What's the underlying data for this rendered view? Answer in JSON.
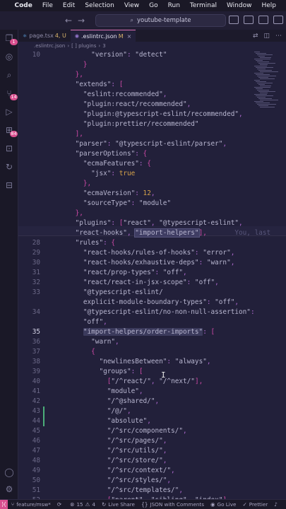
{
  "menubar": {
    "app": "Code",
    "items": [
      "File",
      "Edit",
      "Selection",
      "View",
      "Go",
      "Run",
      "Terminal",
      "Window",
      "Help"
    ]
  },
  "titlebar": {
    "search_text": "youtube-template",
    "back_icon": "arrow-left-icon",
    "forward_icon": "arrow-right-icon"
  },
  "activity": {
    "explorer_badge": "1",
    "scm_badge": "14",
    "extensions_badge": "84"
  },
  "tabs": [
    {
      "label": "page.tsx",
      "suffix": "4, U",
      "active": false
    },
    {
      "label": ".eslintrc.json",
      "suffix": "M",
      "active": true
    }
  ],
  "breadcrumb": {
    "file": ".eslintrc.json",
    "segment": "[ ] plugins",
    "index": "3"
  },
  "editor": {
    "lines": [
      {
        "n": "10",
        "tokens": [
          [
            "        ",
            "s"
          ],
          [
            "\"version\"",
            "k"
          ],
          [
            ": ",
            "p"
          ],
          [
            "\"detect\"",
            "s"
          ]
        ]
      },
      {
        "n": "",
        "tokens": [
          [
            "      ",
            "s"
          ],
          [
            "}",
            "b"
          ]
        ]
      },
      {
        "n": "",
        "tokens": [
          [
            "    ",
            "s"
          ],
          [
            "},",
            "b"
          ]
        ]
      },
      {
        "n": "",
        "tokens": [
          [
            "    ",
            "s"
          ],
          [
            "\"extends\"",
            "k"
          ],
          [
            ": ",
            "p"
          ],
          [
            "[",
            "b"
          ]
        ]
      },
      {
        "n": "",
        "tokens": [
          [
            "      ",
            "s"
          ],
          [
            "\"eslint:recommended\"",
            "s"
          ],
          [
            ",",
            "p"
          ]
        ]
      },
      {
        "n": "",
        "tokens": [
          [
            "      ",
            "s"
          ],
          [
            "\"plugin:react/recommended\"",
            "s"
          ],
          [
            ",",
            "p"
          ]
        ]
      },
      {
        "n": "",
        "tokens": [
          [
            "      ",
            "s"
          ],
          [
            "\"plugin:@typescript-eslint/recommended\"",
            "s"
          ],
          [
            ",",
            "p"
          ]
        ]
      },
      {
        "n": "",
        "tokens": [
          [
            "      ",
            "s"
          ],
          [
            "\"plugin:prettier/recommended\"",
            "s"
          ]
        ]
      },
      {
        "n": "",
        "tokens": [
          [
            "    ",
            "s"
          ],
          [
            "],",
            "b"
          ]
        ]
      },
      {
        "n": "",
        "tokens": [
          [
            "    ",
            "s"
          ],
          [
            "\"parser\"",
            "k"
          ],
          [
            ": ",
            "p"
          ],
          [
            "\"@typescript-eslint/parser\"",
            "s"
          ],
          [
            ",",
            "p"
          ]
        ]
      },
      {
        "n": "",
        "tokens": [
          [
            "    ",
            "s"
          ],
          [
            "\"parserOptions\"",
            "k"
          ],
          [
            ": ",
            "p"
          ],
          [
            "{",
            "b"
          ]
        ]
      },
      {
        "n": "",
        "tokens": [
          [
            "      ",
            "s"
          ],
          [
            "\"ecmaFeatures\"",
            "k"
          ],
          [
            ": ",
            "p"
          ],
          [
            "{",
            "b"
          ]
        ]
      },
      {
        "n": "",
        "tokens": [
          [
            "        ",
            "s"
          ],
          [
            "\"jsx\"",
            "k"
          ],
          [
            ": ",
            "p"
          ],
          [
            "true",
            "n"
          ]
        ]
      },
      {
        "n": "",
        "tokens": [
          [
            "      ",
            "s"
          ],
          [
            "},",
            "b"
          ]
        ]
      },
      {
        "n": "",
        "tokens": [
          [
            "      ",
            "s"
          ],
          [
            "\"ecmaVersion\"",
            "k"
          ],
          [
            ": ",
            "p"
          ],
          [
            "12",
            "n"
          ],
          [
            ",",
            "p"
          ]
        ]
      },
      {
        "n": "",
        "tokens": [
          [
            "      ",
            "s"
          ],
          [
            "\"sourceType\"",
            "k"
          ],
          [
            ": ",
            "p"
          ],
          [
            "\"module\"",
            "s"
          ]
        ]
      },
      {
        "n": "",
        "tokens": [
          [
            "    ",
            "s"
          ],
          [
            "},",
            "b"
          ]
        ]
      },
      {
        "n": "",
        "tokens": [
          [
            "    ",
            "s"
          ],
          [
            "\"plugins\"",
            "k"
          ],
          [
            ": ",
            "p"
          ],
          [
            "[",
            "b"
          ],
          [
            "\"react\"",
            "s"
          ],
          [
            ", ",
            "p"
          ],
          [
            "\"@typescript-eslint\"",
            "s"
          ],
          [
            ",",
            "p"
          ]
        ]
      },
      {
        "n": "",
        "tokens": [
          [
            "    ",
            "s"
          ],
          [
            "\"react-hooks\"",
            "s"
          ],
          [
            ", ",
            "p"
          ],
          [
            "\"import-helpers\"",
            "s"
          ],
          [
            "],",
            "b"
          ],
          [
            "       You, last",
            "g"
          ]
        ]
      },
      {
        "n": "28",
        "tokens": [
          [
            "    ",
            "s"
          ],
          [
            "\"rules\"",
            "k"
          ],
          [
            ": ",
            "p"
          ],
          [
            "{",
            "b"
          ]
        ]
      },
      {
        "n": "29",
        "tokens": [
          [
            "      ",
            "s"
          ],
          [
            "\"react-hooks/rules-of-hooks\"",
            "k"
          ],
          [
            ": ",
            "p"
          ],
          [
            "\"error\"",
            "s"
          ],
          [
            ",",
            "p"
          ]
        ]
      },
      {
        "n": "30",
        "tokens": [
          [
            "      ",
            "s"
          ],
          [
            "\"react-hooks/exhaustive-deps\"",
            "k"
          ],
          [
            ": ",
            "p"
          ],
          [
            "\"warn\"",
            "s"
          ],
          [
            ",",
            "p"
          ]
        ]
      },
      {
        "n": "31",
        "tokens": [
          [
            "      ",
            "s"
          ],
          [
            "\"react/prop-types\"",
            "k"
          ],
          [
            ": ",
            "p"
          ],
          [
            "\"off\"",
            "s"
          ],
          [
            ",",
            "p"
          ]
        ]
      },
      {
        "n": "32",
        "tokens": [
          [
            "      ",
            "s"
          ],
          [
            "\"react/react-in-jsx-scope\"",
            "k"
          ],
          [
            ": ",
            "p"
          ],
          [
            "\"off\"",
            "s"
          ],
          [
            ",",
            "p"
          ]
        ]
      },
      {
        "n": "33",
        "tokens": [
          [
            "      ",
            "s"
          ],
          [
            "\"@typescript-eslint/",
            "k"
          ]
        ]
      },
      {
        "n": "",
        "tokens": [
          [
            "      ",
            "s"
          ],
          [
            "explicit-module-boundary-types\"",
            "k"
          ],
          [
            ": ",
            "p"
          ],
          [
            "\"off\"",
            "s"
          ],
          [
            ",",
            "p"
          ]
        ]
      },
      {
        "n": "34",
        "tokens": [
          [
            "      ",
            "s"
          ],
          [
            "\"@typescript-eslint/no-non-null-assertion\"",
            "k"
          ],
          [
            ":",
            "p"
          ]
        ]
      },
      {
        "n": "",
        "tokens": [
          [
            "      ",
            "s"
          ],
          [
            "\"off\"",
            "s"
          ],
          [
            ",",
            "p"
          ]
        ]
      },
      {
        "n": "35",
        "tokens": [
          [
            "      ",
            "s"
          ],
          [
            "\"import-helpers/order-imports\"",
            "k"
          ],
          [
            ": ",
            "p"
          ],
          [
            "[",
            "b"
          ]
        ]
      },
      {
        "n": "36",
        "tokens": [
          [
            "        ",
            "s"
          ],
          [
            "\"warn\"",
            "s"
          ],
          [
            ",",
            "p"
          ]
        ]
      },
      {
        "n": "37",
        "tokens": [
          [
            "        ",
            "s"
          ],
          [
            "{",
            "b"
          ]
        ]
      },
      {
        "n": "38",
        "tokens": [
          [
            "          ",
            "s"
          ],
          [
            "\"newlinesBetween\"",
            "k"
          ],
          [
            ": ",
            "p"
          ],
          [
            "\"always\"",
            "s"
          ],
          [
            ",",
            "p"
          ]
        ]
      },
      {
        "n": "39",
        "tokens": [
          [
            "          ",
            "s"
          ],
          [
            "\"groups\"",
            "k"
          ],
          [
            ": ",
            "p"
          ],
          [
            "[",
            "b"
          ]
        ]
      },
      {
        "n": "40",
        "tokens": [
          [
            "            ",
            "s"
          ],
          [
            "[",
            "b"
          ],
          [
            "\"/^react/\"",
            "s"
          ],
          [
            ", ",
            "p"
          ],
          [
            "\"/^next/\"",
            "s"
          ],
          [
            "],",
            "b"
          ]
        ]
      },
      {
        "n": "41",
        "tokens": [
          [
            "            ",
            "s"
          ],
          [
            "\"module\"",
            "s"
          ],
          [
            ",",
            "p"
          ]
        ]
      },
      {
        "n": "42",
        "tokens": [
          [
            "            ",
            "s"
          ],
          [
            "\"/^@shared/\"",
            "s"
          ],
          [
            ",",
            "p"
          ]
        ]
      },
      {
        "n": "43",
        "tokens": [
          [
            "            ",
            "s"
          ],
          [
            "\"/@/\"",
            "s"
          ],
          [
            ",",
            "p"
          ]
        ]
      },
      {
        "n": "44",
        "tokens": [
          [
            "            ",
            "s"
          ],
          [
            "\"absolute\"",
            "s"
          ],
          [
            ",",
            "p"
          ]
        ]
      },
      {
        "n": "45",
        "tokens": [
          [
            "            ",
            "s"
          ],
          [
            "\"/^src/components/\"",
            "s"
          ],
          [
            ",",
            "p"
          ]
        ]
      },
      {
        "n": "46",
        "tokens": [
          [
            "            ",
            "s"
          ],
          [
            "\"/^src/pages/\"",
            "s"
          ],
          [
            ",",
            "p"
          ]
        ]
      },
      {
        "n": "47",
        "tokens": [
          [
            "            ",
            "s"
          ],
          [
            "\"/^src/utils/\"",
            "s"
          ],
          [
            ",",
            "p"
          ]
        ]
      },
      {
        "n": "48",
        "tokens": [
          [
            "            ",
            "s"
          ],
          [
            "\"/^src/store/\"",
            "s"
          ],
          [
            ",",
            "p"
          ]
        ]
      },
      {
        "n": "49",
        "tokens": [
          [
            "            ",
            "s"
          ],
          [
            "\"/^src/context/\"",
            "s"
          ],
          [
            ",",
            "p"
          ]
        ]
      },
      {
        "n": "50",
        "tokens": [
          [
            "            ",
            "s"
          ],
          [
            "\"/^src/styles/\"",
            "s"
          ],
          [
            ",",
            "p"
          ]
        ]
      },
      {
        "n": "51",
        "tokens": [
          [
            "            ",
            "s"
          ],
          [
            "\"/^src/templates/\"",
            "s"
          ],
          [
            ",",
            "p"
          ]
        ]
      },
      {
        "n": "52",
        "tokens": [
          [
            "            ",
            "s"
          ],
          [
            "[",
            "b"
          ],
          [
            "\"parent\"",
            "s"
          ],
          [
            ", ",
            "p"
          ],
          [
            "\"sibling\"",
            "s"
          ],
          [
            ", ",
            "p"
          ],
          [
            "\"index\"",
            "s"
          ],
          [
            "]",
            "b"
          ]
        ]
      }
    ]
  },
  "statusbar": {
    "branch": "feature/msw*",
    "sync_icon": "sync-icon",
    "errors": "15",
    "warnings": "4",
    "live_share": "Live Share",
    "json_comments": "JSON with Comments",
    "go_live": "Go Live",
    "prettier": "Prettier"
  },
  "colors": {
    "accent": "#d94f8f",
    "editor_bg": "#22203a",
    "string": "#b8b6d0",
    "bracket": "#d04aa8",
    "number": "#d6a24a"
  }
}
